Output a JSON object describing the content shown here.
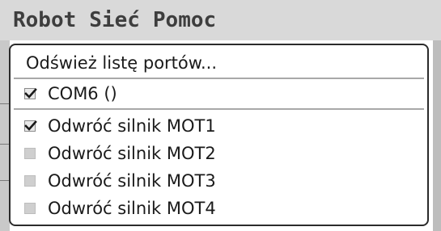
{
  "menubar": {
    "items": [
      {
        "label": "Robot"
      },
      {
        "label": "Sieć"
      },
      {
        "label": "Pomoc"
      }
    ]
  },
  "dropdown": {
    "refresh_label": "Odśwież listę portów...",
    "port_label": "COM6 ()",
    "port_checked": true,
    "motors": [
      {
        "label": "Odwróć silnik MOT1",
        "checked": true
      },
      {
        "label": "Odwróć silnik MOT2",
        "checked": false
      },
      {
        "label": "Odwróć silnik MOT3",
        "checked": false
      },
      {
        "label": "Odwróć silnik MOT4",
        "checked": false
      }
    ]
  },
  "colors": {
    "menubar_bg": "#d9d9d9",
    "menubar_text": "#3e3e3e",
    "dropdown_border": "#2b2b2b",
    "separator": "#a8a8a8"
  }
}
